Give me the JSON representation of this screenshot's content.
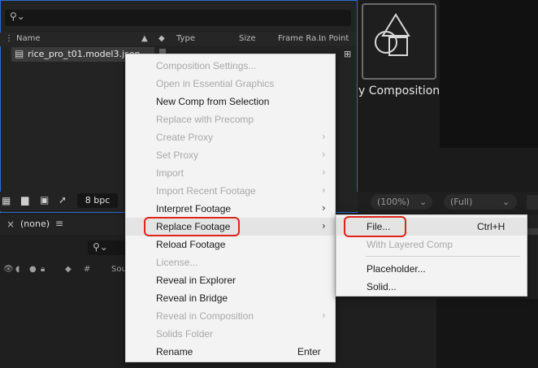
{
  "project": {
    "search_icon": "search-icon",
    "columns": {
      "name": "Name",
      "type": "Type",
      "size": "Size",
      "frame_rate": "Frame Ra...",
      "in_point": "In Point"
    },
    "selected_file": "rice_pro_t01.model3.json",
    "bpc": "8 bpc"
  },
  "viewer": {
    "comp_label": "y Composition",
    "zoom": "(100%)",
    "resolution": "(Full)"
  },
  "timeline": {
    "tab_label": "(none)",
    "col_hash": "#",
    "col_source": "Sou"
  },
  "context_menu": {
    "items": [
      {
        "label": "Composition Settings...",
        "enabled": false
      },
      {
        "label": "Open in Essential Graphics",
        "enabled": false
      },
      {
        "label": "New Comp from Selection",
        "enabled": true
      },
      {
        "label": "Replace with Precomp",
        "enabled": false
      },
      {
        "label": "Create Proxy",
        "enabled": false,
        "submenu": true
      },
      {
        "label": "Set Proxy",
        "enabled": false,
        "submenu": true
      },
      {
        "label": "Import",
        "enabled": false,
        "submenu": true
      },
      {
        "label": "Import Recent Footage",
        "enabled": false,
        "submenu": true
      },
      {
        "label": "Interpret Footage",
        "enabled": true,
        "submenu": true
      },
      {
        "label": "Replace Footage",
        "enabled": true,
        "submenu": true,
        "highlighted": true
      },
      {
        "label": "Reload Footage",
        "enabled": true
      },
      {
        "label": "License...",
        "enabled": false
      },
      {
        "label": "Reveal in Explorer",
        "enabled": true
      },
      {
        "label": "Reveal in Bridge",
        "enabled": true
      },
      {
        "label": "Reveal in Composition",
        "enabled": false,
        "submenu": true
      },
      {
        "label": "Solids Folder",
        "enabled": false
      },
      {
        "label": "Rename",
        "enabled": true,
        "shortcut": "Enter"
      }
    ],
    "chevron": "›"
  },
  "sub_menu": {
    "items": [
      {
        "label": "File...",
        "enabled": true,
        "shortcut": "Ctrl+H",
        "highlighted": true
      },
      {
        "label": "With Layered Comp",
        "enabled": false
      },
      {
        "label": "Placeholder...",
        "enabled": true
      },
      {
        "label": "Solid...",
        "enabled": true
      }
    ]
  },
  "colors": {
    "selection_border": "#2e6bd1",
    "annotation_ring": "#e0241b"
  }
}
